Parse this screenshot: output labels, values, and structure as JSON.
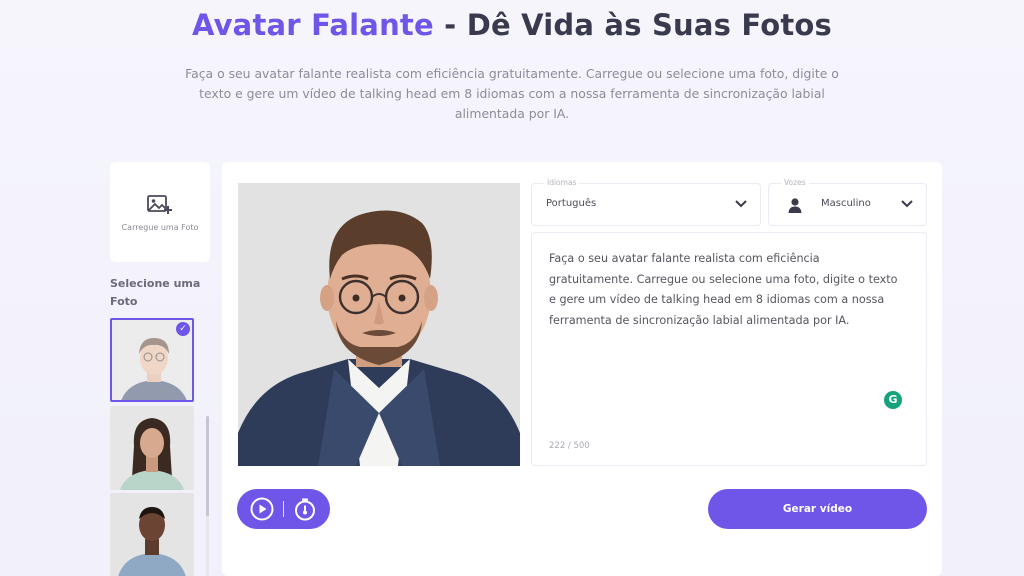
{
  "hero": {
    "title_accent": "Avatar Falante",
    "title_rest": " - Dê Vida às Suas Fotos",
    "description": "Faça o seu avatar falante realista com eficiência gratuitamente. Carregue ou selecione uma foto, digite o texto e gere um vídeo de talking head em 8 idiomas com a nossa ferramenta de sincronização labial alimentada por IA."
  },
  "sidebar": {
    "upload_label": "Carregue uma Foto",
    "select_label": "Selecione uma Foto",
    "photos": [
      {
        "name": "photo-man-glasses",
        "selected": true
      },
      {
        "name": "photo-woman",
        "selected": false
      },
      {
        "name": "photo-man-dark",
        "selected": false
      }
    ]
  },
  "editor": {
    "language": {
      "legend": "Idiomas",
      "value": "Português"
    },
    "voice": {
      "legend": "Vozes",
      "value": "Masculino"
    },
    "text": "Faça o seu avatar falante realista com eficiência gratuitamente. Carregue ou selecione uma foto, digite o texto e gere um vídeo de talking head em 8 idiomas com a nossa ferramenta de sincronização labial alimentada por IA.",
    "char_count": "222 / 500",
    "generate_label": "Gerar vídeo"
  },
  "colors": {
    "accent": "#6f55e8",
    "background": "#f4f3fb",
    "grammarly": "#15a37e"
  },
  "icons": {
    "upload": "image-plus-icon",
    "check": "check-icon",
    "chevron": "chevron-down-icon",
    "person": "person-icon",
    "play": "play-icon",
    "timer": "timer-icon",
    "grammarly": "grammarly-icon"
  }
}
